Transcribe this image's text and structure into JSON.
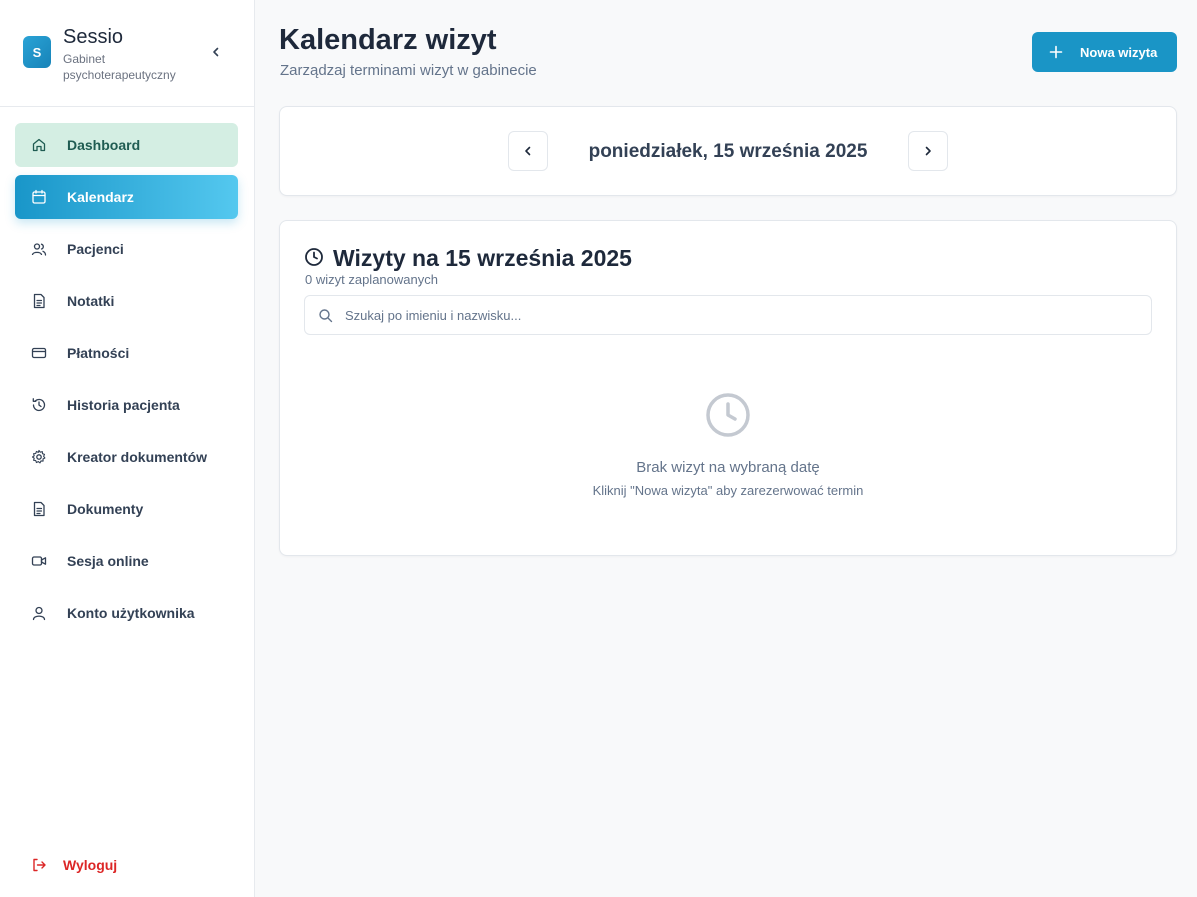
{
  "brand": {
    "logo_letter": "S",
    "name": "Sessio",
    "subtitle": "Gabinet psychoterapeutyczny"
  },
  "sidebar": {
    "items": [
      {
        "label": "Dashboard",
        "icon": "home-icon",
        "state": "hover"
      },
      {
        "label": "Kalendarz",
        "icon": "calendar-icon",
        "state": "active"
      },
      {
        "label": "Pacjenci",
        "icon": "users-icon"
      },
      {
        "label": "Notatki",
        "icon": "file-text-icon"
      },
      {
        "label": "Płatności",
        "icon": "credit-card-icon"
      },
      {
        "label": "Historia pacjenta",
        "icon": "history-icon"
      },
      {
        "label": "Kreator dokumentów",
        "icon": "gear-icon"
      },
      {
        "label": "Dokumenty",
        "icon": "document-icon"
      },
      {
        "label": "Sesja online",
        "icon": "video-icon"
      },
      {
        "label": "Konto użytkownika",
        "icon": "user-icon"
      }
    ],
    "logout_label": "Wyloguj"
  },
  "header": {
    "title": "Kalendarz wizyt",
    "subtitle": "Zarządzaj terminami wizyt w gabinecie",
    "new_button_label": "Nowa wizyta"
  },
  "date_nav": {
    "current_date": "poniedziałek, 15 września 2025"
  },
  "visits": {
    "title": "Wizyty na 15 września 2025",
    "count_text": "0 wizyt zaplanowanych",
    "search_placeholder": "Szukaj po imieniu i nazwisku...",
    "empty_title": "Brak wizyt na wybraną datę",
    "empty_subtitle": "Kliknij \"Nowa wizyta\" aby zarezerwować termin"
  },
  "colors": {
    "accent": "#1a95c6",
    "active_gradient_end": "#54c8ef",
    "hover_bg": "#d4eee3",
    "logout": "#dc2626"
  }
}
